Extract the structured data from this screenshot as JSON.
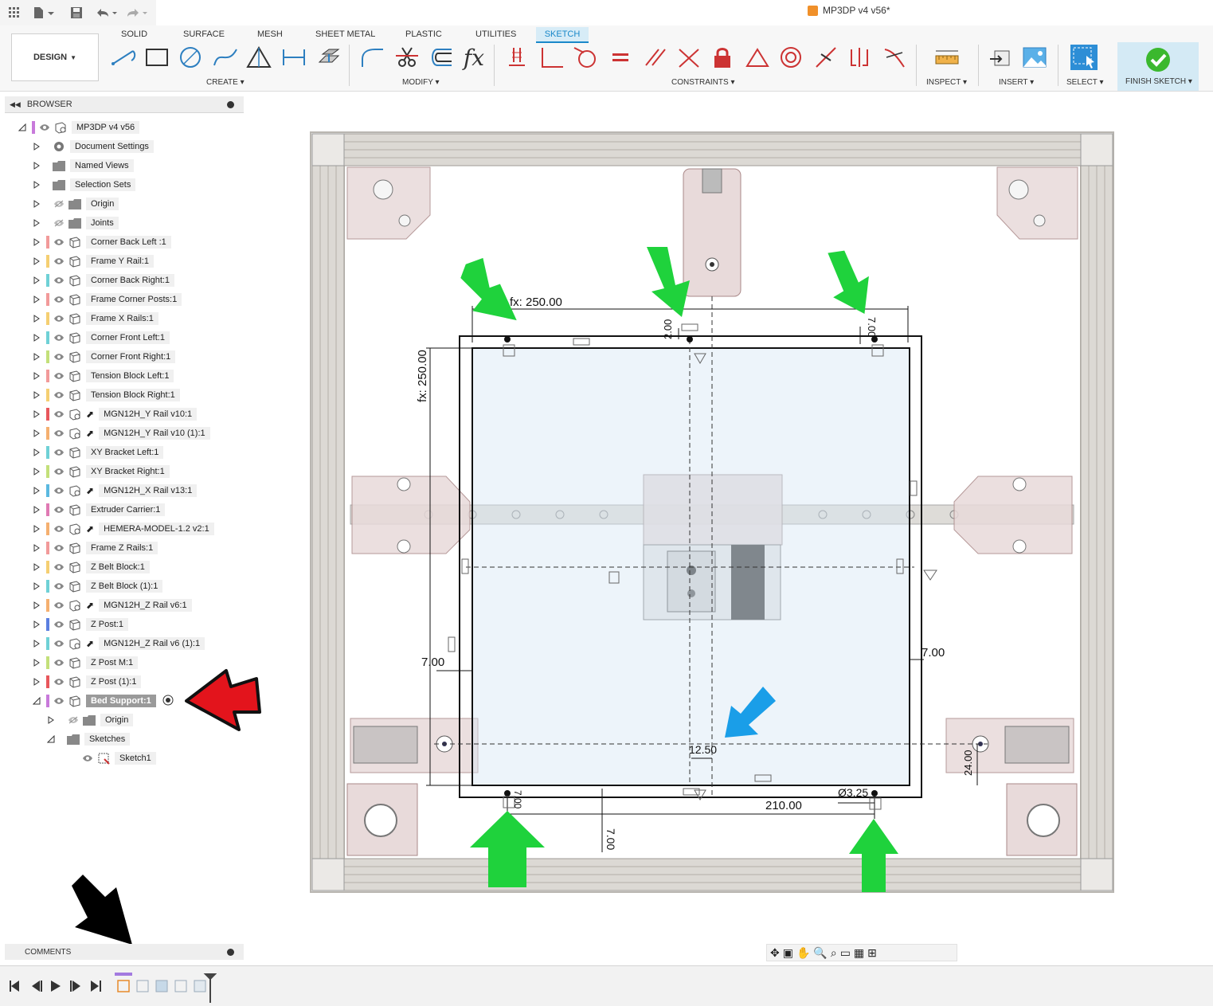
{
  "quick_access": {
    "document_title": "MP3DP v4 v56*"
  },
  "ribbon": {
    "tabs": [
      {
        "label": "SOLID",
        "active": false
      },
      {
        "label": "SURFACE",
        "active": false
      },
      {
        "label": "MESH",
        "active": false
      },
      {
        "label": "SHEET METAL",
        "active": false
      },
      {
        "label": "PLASTIC",
        "active": false
      },
      {
        "label": "UTILITIES",
        "active": false
      },
      {
        "label": "SKETCH",
        "active": true
      }
    ],
    "workspace": "DESIGN",
    "groups": {
      "create": "CREATE",
      "modify": "MODIFY",
      "constraints": "CONSTRAINTS",
      "inspect": "INSPECT",
      "insert": "INSERT",
      "select": "SELECT",
      "finish": "FINISH SKETCH"
    },
    "accent_color": "#1a88c9"
  },
  "browser": {
    "title": "BROWSER",
    "items": [
      {
        "label": "MP3DP v4 v56",
        "color": "#c87adb"
      },
      {
        "label": "Document Settings",
        "color": ""
      },
      {
        "label": "Named Views",
        "color": ""
      },
      {
        "label": "Selection Sets",
        "color": ""
      },
      {
        "label": "Origin",
        "color": ""
      },
      {
        "label": "Joints",
        "color": ""
      },
      {
        "label": "Corner Back Left :1",
        "color": "#f29a9a"
      },
      {
        "label": "Frame Y Rail:1",
        "color": "#f5cf72"
      },
      {
        "label": "Corner Back Right:1",
        "color": "#6fd1d6"
      },
      {
        "label": "Frame Corner Posts:1",
        "color": "#f29a9a"
      },
      {
        "label": "Frame X Rails:1",
        "color": "#f5cf72"
      },
      {
        "label": "Corner Front Left:1",
        "color": "#6fd1d6"
      },
      {
        "label": "Corner Front Right:1",
        "color": "#c3e07a"
      },
      {
        "label": "Tension Block Left:1",
        "color": "#f29a9a"
      },
      {
        "label": "Tension Block Right:1",
        "color": "#f5cf72"
      },
      {
        "label": "MGN12H_Y Rail v10:1",
        "color": "#e8575c"
      },
      {
        "label": "MGN12H_Y Rail v10 (1):1",
        "color": "#f5b070"
      },
      {
        "label": "XY Bracket Left:1",
        "color": "#6fd1d6"
      },
      {
        "label": "XY Bracket Right:1",
        "color": "#c3e07a"
      },
      {
        "label": "MGN12H_X Rail v13:1",
        "color": "#5bb9e0"
      },
      {
        "label": "Extruder Carrier:1",
        "color": "#e07ab4"
      },
      {
        "label": "HEMERA-MODEL-1.2 v2:1",
        "color": "#f5b070"
      },
      {
        "label": "Frame Z Rails:1",
        "color": "#f29a9a"
      },
      {
        "label": "Z Belt Block:1",
        "color": "#f5cf72"
      },
      {
        "label": "Z Belt Block (1):1",
        "color": "#6fd1d6"
      },
      {
        "label": "MGN12H_Z Rail v6:1",
        "color": "#f5b070"
      },
      {
        "label": "Z Post:1",
        "color": "#5b7fe0"
      },
      {
        "label": "MGN12H_Z Rail v6 (1):1",
        "color": "#6fd1d6"
      },
      {
        "label": "Z Post M:1",
        "color": "#c3e07a"
      },
      {
        "label": "Z Post (1):1",
        "color": "#e8575c"
      },
      {
        "label": "Bed Support:1",
        "color": "#c87adb"
      },
      {
        "label": "Origin",
        "color": ""
      },
      {
        "label": "Sketches",
        "color": ""
      },
      {
        "label": "Sketch1",
        "color": ""
      }
    ]
  },
  "comments": {
    "title": "COMMENTS"
  },
  "sketch": {
    "dimensions": {
      "top_width": "fx: 250.00",
      "left_height": "fx: 250.00",
      "top_offset": "2.00",
      "right_top_offset": "7.00",
      "left_offset": "7.00",
      "right_offset": "7.00",
      "center_offset": "12.50",
      "hole_diameter": "Ø3.25",
      "hole_spacing": "210.00",
      "bottom_offset": "7.00",
      "right_vertical": "24.00",
      "bottom_left_small": "7.00"
    },
    "arrow_colors": {
      "green": "#1fd23c",
      "blue": "#1a9ee8",
      "red": "#e3141c",
      "black": "#000000"
    }
  }
}
